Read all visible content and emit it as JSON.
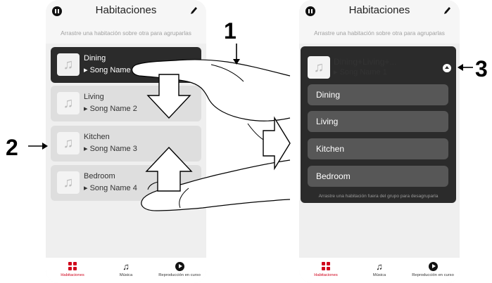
{
  "left_phone": {
    "title": "Habitaciones",
    "hint": "Arrastre una habitación sobre otra para agruparlas",
    "rooms": [
      {
        "name": "Dining",
        "song": "Song Name 1",
        "selected": true
      },
      {
        "name": "Living",
        "song": "Song Name 2"
      },
      {
        "name": "Kitchen",
        "song": "Song Name 3"
      },
      {
        "name": "Bedroom",
        "song": "Song Name 4"
      }
    ],
    "tabs": [
      {
        "label": "Habitaciones",
        "icon": "rooms-icon",
        "active": true
      },
      {
        "label": "Música",
        "icon": "music-note-icon"
      },
      {
        "label": "Reproducción en curso",
        "icon": "play-circle-icon"
      }
    ]
  },
  "right_phone": {
    "title": "Habitaciones",
    "hint": "Arrastre una habitación sobre otra para agruparlas",
    "group": {
      "name": "Dining+Living+...",
      "song": "Song Name 1",
      "members": [
        "Dining",
        "Living",
        "Kitchen",
        "Bedroom"
      ],
      "hint": "Arrastre una habitación fuera del grupo para desagruparla"
    },
    "tabs": [
      {
        "label": "Habitaciones",
        "icon": "rooms-icon",
        "active": true
      },
      {
        "label": "Música",
        "icon": "music-note-icon"
      },
      {
        "label": "Reproducción en curso",
        "icon": "play-circle-icon"
      }
    ]
  },
  "callouts": {
    "step1": "1",
    "step2": "2",
    "step3": "3"
  },
  "colors": {
    "accent": "#d0021b",
    "selected_row": "#2b2b2b",
    "row": "#dedede",
    "group_member": "#575757"
  }
}
